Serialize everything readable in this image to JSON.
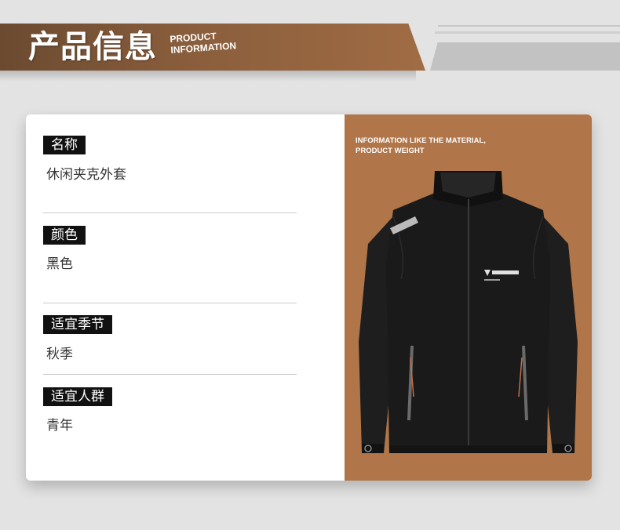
{
  "header": {
    "title": "产品信息",
    "subtitle_line1": "PRODUCT",
    "subtitle_line2": "INFORMATION"
  },
  "info": [
    {
      "label": "名称",
      "value": "休闲夹克外套"
    },
    {
      "label": "颜色",
      "value": "黑色"
    },
    {
      "label": "适宜季节",
      "value": "秋季"
    },
    {
      "label": "适宜人群",
      "value": "青年"
    }
  ],
  "photo": {
    "caption_line1": "INFORMATION LIKE THE MATERIAL,",
    "caption_line2": "PRODUCT WEIGHT",
    "jacket_color": "#1a1a1a",
    "background_color": "#b07548"
  },
  "colors": {
    "banner": "#8a5e3c",
    "label_bg": "#111111",
    "page_bg": "#e3e3e3"
  }
}
